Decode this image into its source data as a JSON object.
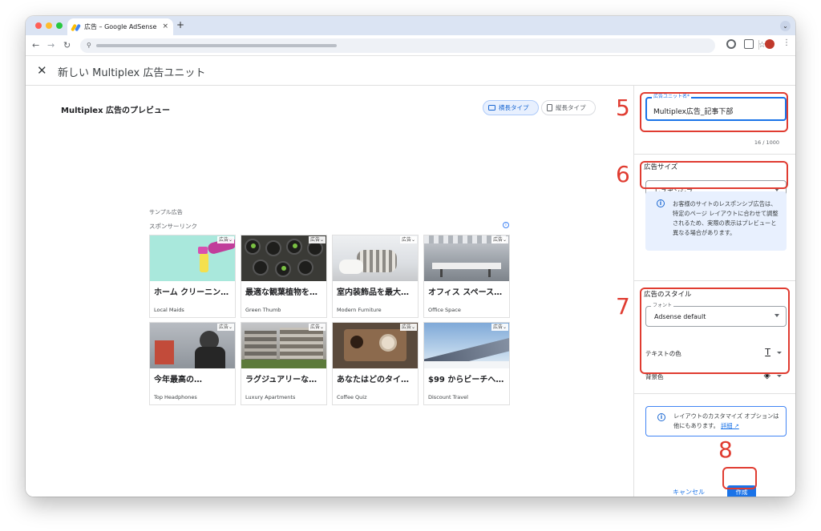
{
  "browser": {
    "tab_title": "広告 – Google AdSense",
    "tab_close": "×",
    "new_tab": "+",
    "tab_search": "⌄",
    "back": "←",
    "forward": "→",
    "reload": "↻",
    "site_info": "⚲",
    "star": "☆",
    "menu": "⋮"
  },
  "header": {
    "close": "✕",
    "title": "新しい Multiplex 広告ユニット"
  },
  "preview": {
    "title": "Multiplex 広告のプレビュー",
    "layout_horizontal": "横長タイプ",
    "layout_vertical": "縦長タイプ",
    "sample_label": "サンプル広告",
    "sponsored_label": "スポンサーリンク",
    "info": "i",
    "ad_badge": "広告",
    "cards": [
      {
        "title": "ホーム クリーニン…",
        "advertiser": "Local Maids"
      },
      {
        "title": "最適な観葉植物を…",
        "advertiser": "Green Thumb"
      },
      {
        "title": "室内装飾品を最大…",
        "advertiser": "Modern Furniture"
      },
      {
        "title": "オフィス スペース…",
        "advertiser": "Office Space"
      },
      {
        "title": "今年最高の…",
        "advertiser": "Top Headphones"
      },
      {
        "title": "ラグジュアリーな…",
        "advertiser": "Luxury Apartments"
      },
      {
        "title": "あなたはどのタイ…",
        "advertiser": "Coffee Quiz"
      },
      {
        "title": "$99 からビーチへ…",
        "advertiser": "Discount Travel"
      }
    ]
  },
  "panel": {
    "unit_name_label": "広告ユニット名*",
    "unit_name_value": "Multiplex広告_記事下部",
    "unit_name_count": "16 / 1000",
    "ad_size_label": "広告サイズ",
    "ad_size_value": "レスポンシブ",
    "info_icon": "i",
    "responsive_info": "お客様のサイトのレスポンシブ広告は、特定のページ レイアウトに合わせて調整されるため、実際の表示はプレビューと異なる場合があります。",
    "ad_style_label": "広告のスタイル",
    "font_legend": "フォント",
    "font_value": "Adsense default",
    "text_color_label": "テキストの色",
    "text_color_icon": "T",
    "bg_color_label": "背景色",
    "bg_color_icon": "◈",
    "customize_text": "レイアウトのカスタマイズ オプションは他にもあります。",
    "customize_link": "詳細 ↗",
    "cancel": "キャンセル",
    "create": "作成"
  },
  "annotations": {
    "step5": "5",
    "step6": "6",
    "step7": "7",
    "step8": "8"
  },
  "colors": {
    "accent": "#1a73e8",
    "annotation": "#e03c31",
    "info_bg": "#e8f0fe"
  }
}
